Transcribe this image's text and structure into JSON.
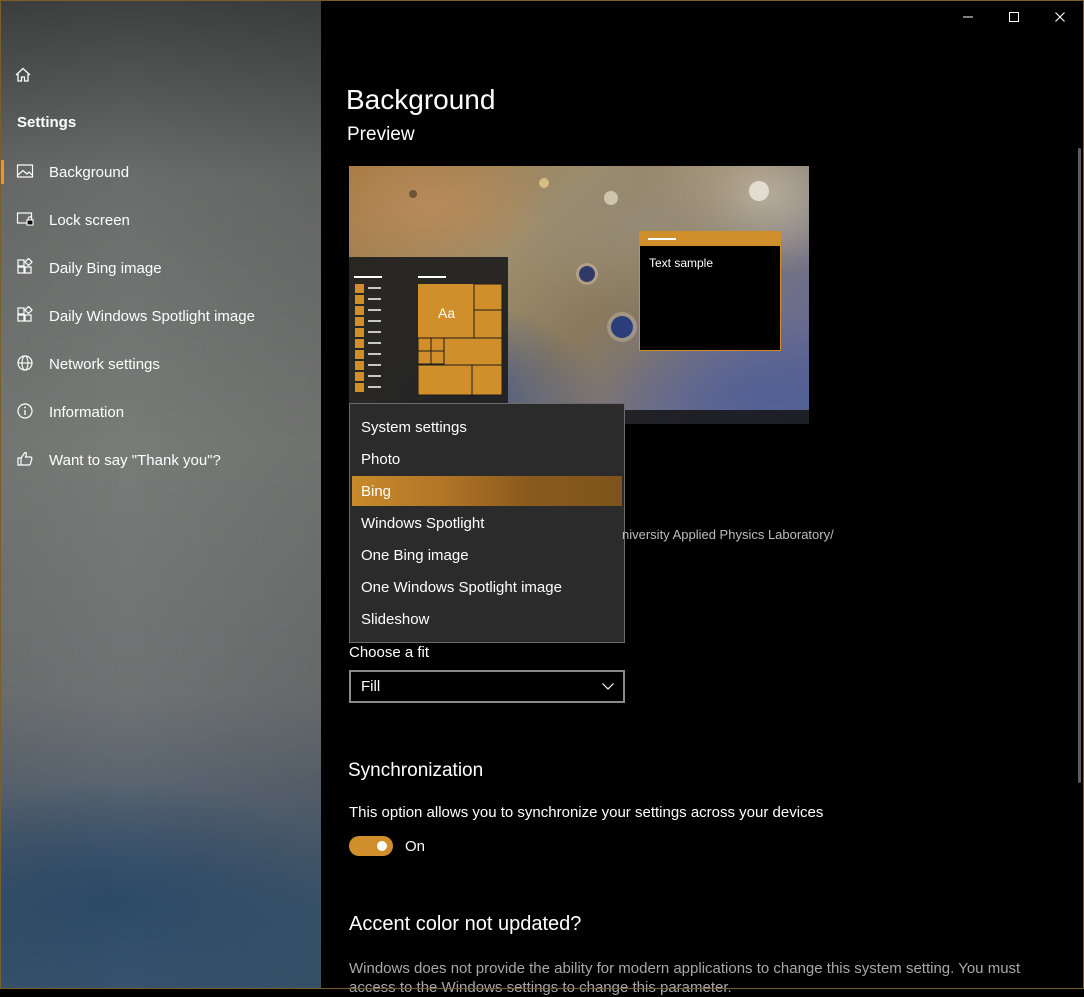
{
  "sidebar": {
    "title": "Settings",
    "items": [
      {
        "label": "Background",
        "icon": "picture-icon",
        "active": true
      },
      {
        "label": "Lock screen",
        "icon": "lock-screen-icon",
        "active": false
      },
      {
        "label": "Daily Bing image",
        "icon": "apps-icon",
        "active": false
      },
      {
        "label": "Daily Windows Spotlight image",
        "icon": "apps-icon",
        "active": false
      },
      {
        "label": "Network settings",
        "icon": "globe-icon",
        "active": false
      },
      {
        "label": "Information",
        "icon": "info-icon",
        "active": false
      },
      {
        "label": "Want to say \"Thank you\"?",
        "icon": "thumbs-up-icon",
        "active": false
      }
    ]
  },
  "main": {
    "title": "Background",
    "preview_label": "Preview",
    "preview": {
      "tile_text": "Aa",
      "sample_text": "Text sample"
    },
    "background_dropdown": {
      "options": [
        "System settings",
        "Photo",
        "Bing",
        "Windows Spotlight",
        "One Bing image",
        "One Windows Spotlight image",
        "Slideshow"
      ],
      "selected": "Bing"
    },
    "credit_text": "niversity Applied Physics Laboratory/",
    "fit": {
      "label": "Choose a fit",
      "value": "Fill"
    },
    "sync": {
      "title": "Synchronization",
      "description": "This option allows you to synchronize your settings across your devices",
      "toggle_label": "On",
      "on": true
    },
    "accent": {
      "title": "Accent color not updated?",
      "description": "Windows does not provide the ability for modern applications to change this system setting. You must access to the Windows settings to change this parameter."
    }
  },
  "colors": {
    "accent": "#d08f2a",
    "selected_option": "#b07426",
    "background": "#000000"
  }
}
